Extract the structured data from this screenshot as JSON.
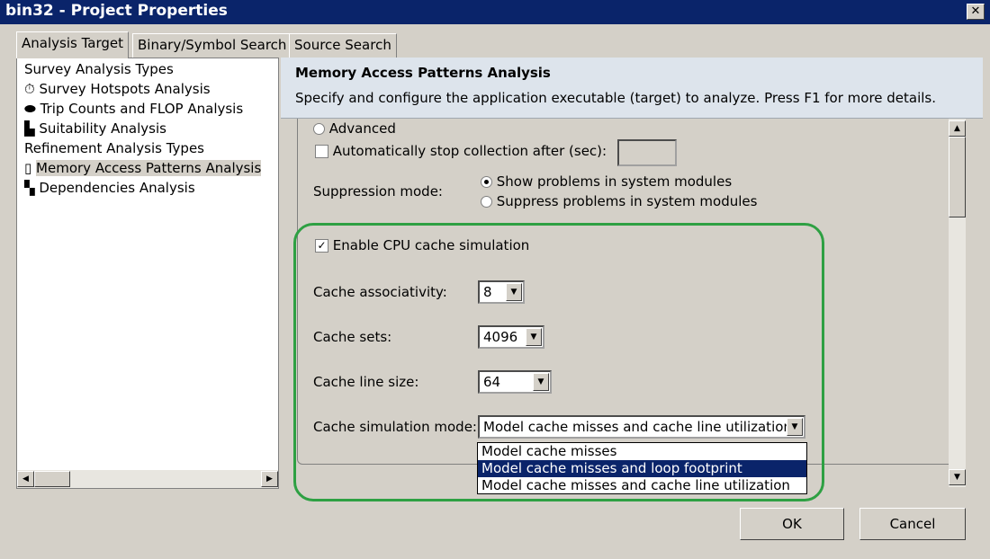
{
  "window": {
    "title": "bin32 - Project Properties",
    "close": "✕"
  },
  "tabs": [
    "Analysis Target",
    "Binary/Symbol Search",
    "Source Search"
  ],
  "tree": {
    "items": [
      {
        "label": "Survey Analysis Types",
        "icon": ""
      },
      {
        "label": "Survey Hotspots Analysis",
        "icon": "stopwatch-icon",
        "glyph": "⏱"
      },
      {
        "label": "Trip Counts and FLOP Analysis",
        "icon": "ring-icon",
        "glyph": "⬬"
      },
      {
        "label": "Suitability Analysis",
        "icon": "puzzle-icon",
        "glyph": "▙"
      },
      {
        "label": "Refinement Analysis Types",
        "icon": ""
      },
      {
        "label": "Memory Access Patterns Analysis",
        "icon": "memory-icon",
        "glyph": "▯"
      },
      {
        "label": "Dependencies Analysis",
        "icon": "dependencies-icon",
        "glyph": "▚"
      }
    ]
  },
  "header": {
    "title": "Memory Access Patterns Analysis",
    "description": "Specify and configure the application executable (target) to analyze. Press F1 for more details."
  },
  "form": {
    "advanced_label": "Advanced",
    "auto_stop_label": "Automatically stop collection after (sec):",
    "auto_stop_value": "",
    "suppression_label": "Suppression mode:",
    "suppression_options": [
      "Show problems in system modules",
      "Suppress problems in system modules"
    ],
    "cache_sim_label": "Enable CPU cache simulation",
    "cache_sim_checked": "✓",
    "assoc_label": "Cache associativity:",
    "assoc_value": "8",
    "sets_label": "Cache sets:",
    "sets_value": "4096",
    "line_label": "Cache line size:",
    "line_value": "64",
    "mode_label": "Cache simulation mode:",
    "mode_value": "Model cache misses and cache line utilization",
    "mode_options": [
      "Model cache misses",
      "Model cache misses and loop footprint",
      "Model cache misses and cache line utilization"
    ]
  },
  "buttons": {
    "ok": "OK",
    "cancel": "Cancel"
  },
  "arrows": {
    "down": "▼",
    "up": "▲",
    "left": "◀",
    "right": "▶"
  }
}
